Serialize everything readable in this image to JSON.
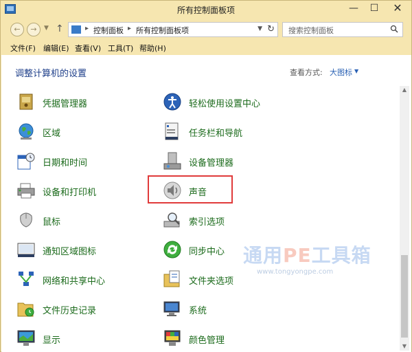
{
  "window": {
    "title": "所有控制面板项"
  },
  "titlebar": {
    "minimize_glyph": "—",
    "maximize_glyph": "☐",
    "close_glyph": "✕"
  },
  "nav": {
    "back_glyph": "←",
    "forward_glyph": "→",
    "up_glyph": "↑",
    "breadcrumb": [
      "控制面板",
      "所有控制面板项"
    ],
    "search_placeholder": "搜索控制面板"
  },
  "menu": [
    {
      "label": "文件(F)"
    },
    {
      "label": "编辑(E)"
    },
    {
      "label": "查看(V)"
    },
    {
      "label": "工具(T)"
    },
    {
      "label": "帮助(H)"
    }
  ],
  "content": {
    "header_title": "调整计算机的设置",
    "view_by_label": "查看方式:",
    "view_by_value": "大图标"
  },
  "items": [
    {
      "label": "凭据管理器",
      "icon": "credential-manager-icon"
    },
    {
      "label": "轻松使用设置中心",
      "icon": "ease-of-access-icon"
    },
    {
      "label": "区域",
      "icon": "region-globe-icon"
    },
    {
      "label": "任务栏和导航",
      "icon": "taskbar-icon"
    },
    {
      "label": "日期和时间",
      "icon": "date-time-icon"
    },
    {
      "label": "设备管理器",
      "icon": "device-manager-icon"
    },
    {
      "label": "设备和打印机",
      "icon": "printer-icon"
    },
    {
      "label": "声音",
      "icon": "speaker-icon"
    },
    {
      "label": "鼠标",
      "icon": "mouse-icon"
    },
    {
      "label": "索引选项",
      "icon": "indexing-icon"
    },
    {
      "label": "通知区域图标",
      "icon": "notification-area-icon"
    },
    {
      "label": "同步中心",
      "icon": "sync-center-icon"
    },
    {
      "label": "网络和共享中心",
      "icon": "network-icon"
    },
    {
      "label": "文件夹选项",
      "icon": "folder-options-icon"
    },
    {
      "label": "文件历史记录",
      "icon": "file-history-icon"
    },
    {
      "label": "系统",
      "icon": "system-icon"
    },
    {
      "label": "显示",
      "icon": "display-icon"
    },
    {
      "label": "颜色管理",
      "icon": "color-management-icon"
    }
  ],
  "watermark": {
    "pre": "通用",
    "pe": "PE",
    "post": "工具箱",
    "url": "www.tongyongpe.com"
  }
}
